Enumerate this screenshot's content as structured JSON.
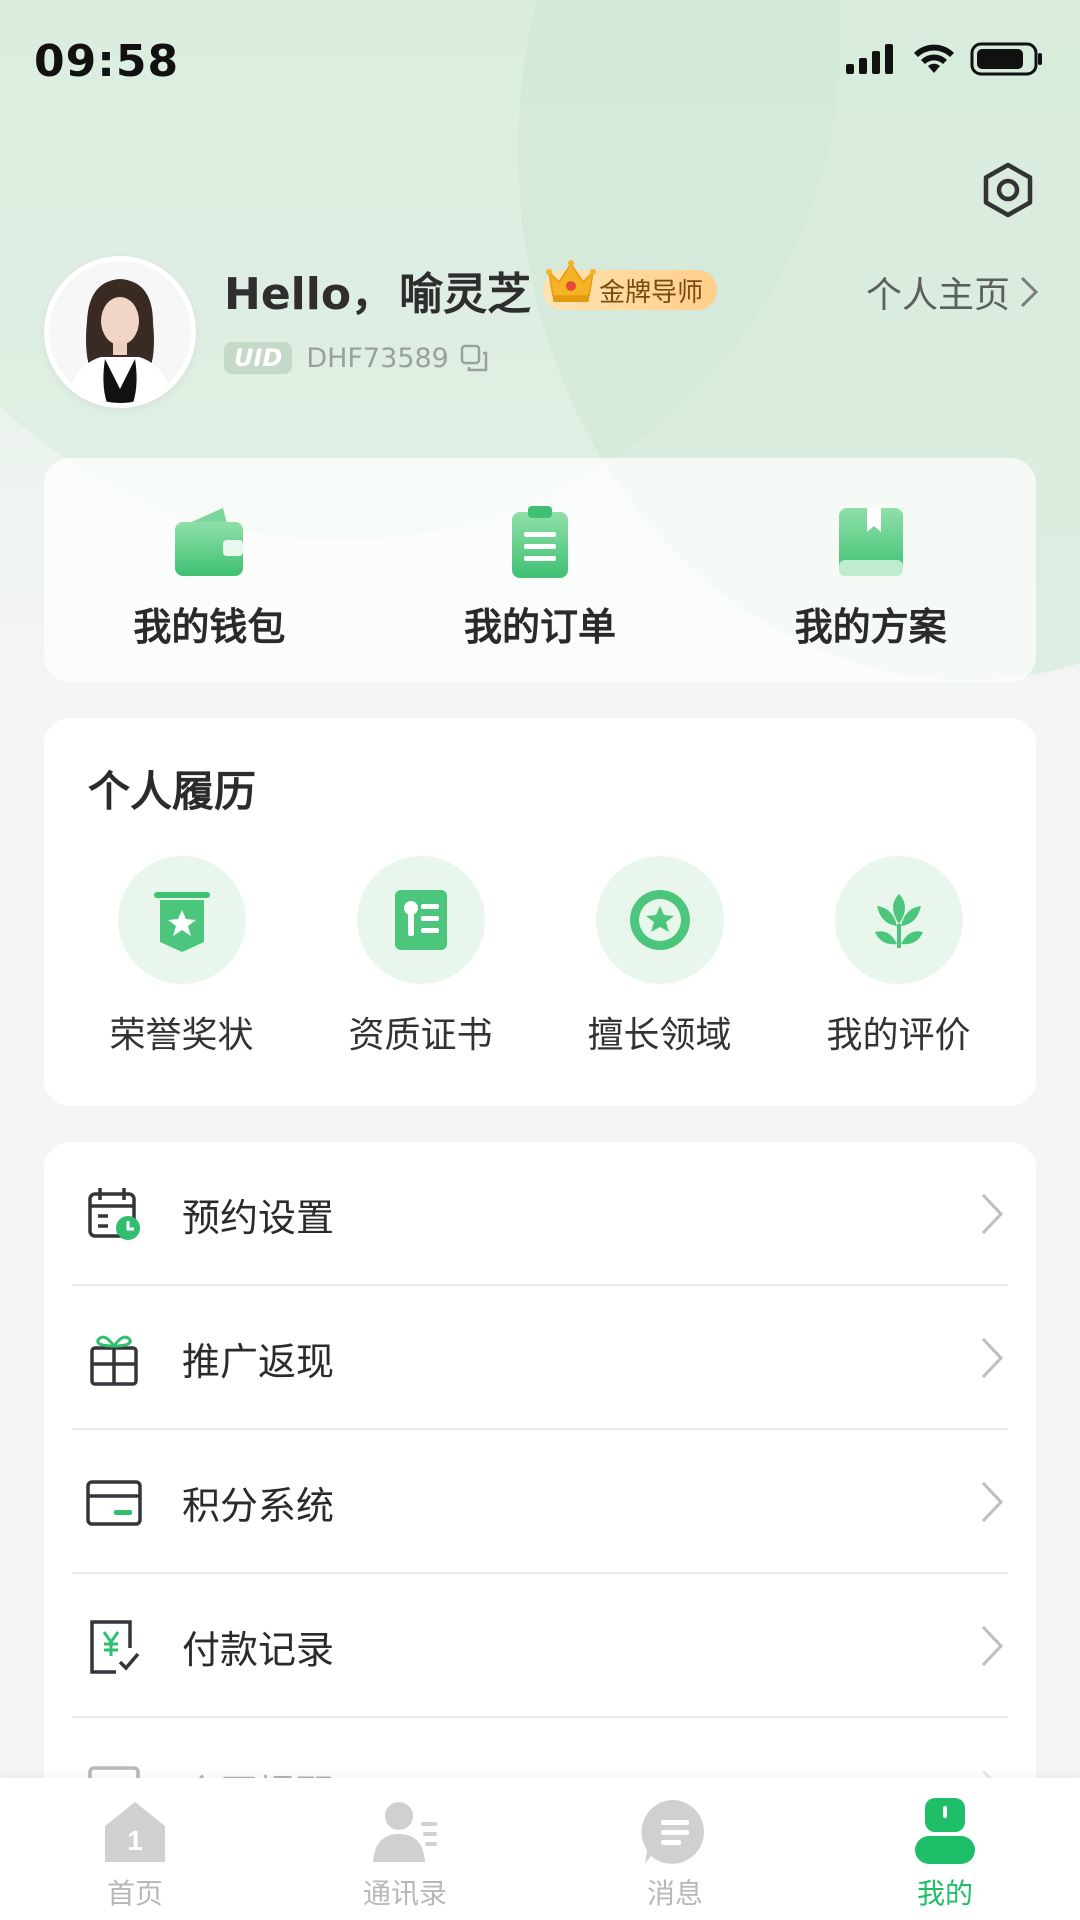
{
  "status_bar": {
    "time": "09:58"
  },
  "profile": {
    "greeting": "Hello，",
    "name": "喻灵芝",
    "badge": "金牌导师",
    "uid_label": "UID",
    "uid": "DHF73589",
    "home_link": "个人主页"
  },
  "quick_actions": [
    {
      "label": "我的钱包",
      "icon": "wallet-icon"
    },
    {
      "label": "我的订单",
      "icon": "order-clipboard-icon"
    },
    {
      "label": "我的方案",
      "icon": "book-icon"
    }
  ],
  "resume": {
    "title": "个人履历",
    "items": [
      {
        "label": "荣誉奖状",
        "icon": "award-banner-icon"
      },
      {
        "label": "资质证书",
        "icon": "certificate-icon"
      },
      {
        "label": "擅长领域",
        "icon": "star-circle-icon"
      },
      {
        "label": "我的评价",
        "icon": "lotus-icon"
      }
    ]
  },
  "menu": [
    {
      "label": "预约设置",
      "icon": "calendar-clock-icon"
    },
    {
      "label": "推广返现",
      "icon": "gift-icon"
    },
    {
      "label": "积分系统",
      "icon": "card-icon"
    },
    {
      "label": "付款记录",
      "icon": "payment-record-icon"
    },
    {
      "label": "合同提醒",
      "icon": "contract-icon"
    }
  ],
  "tabbar": [
    {
      "label": "首页",
      "icon": "home-icon",
      "active": false
    },
    {
      "label": "通讯录",
      "icon": "contacts-icon",
      "active": false
    },
    {
      "label": "消息",
      "icon": "message-icon",
      "active": false
    },
    {
      "label": "我的",
      "icon": "profile-icon",
      "active": true
    }
  ],
  "colors": {
    "accent": "#1fbf6a",
    "accent_light": "#e9f6ec",
    "badge_bg": "#ffce8a"
  }
}
